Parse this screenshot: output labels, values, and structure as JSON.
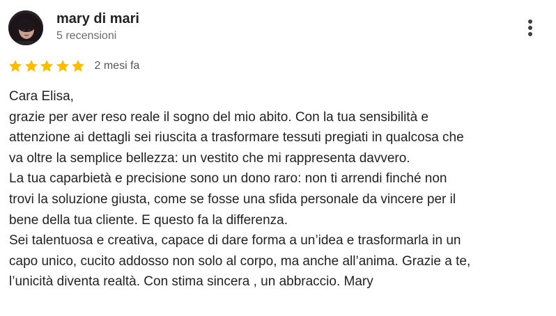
{
  "reviewer": {
    "name": "mary di mari",
    "review_count": "5 recensioni"
  },
  "rating": {
    "stars": 5,
    "max": 5,
    "star_color": "#fbbc04",
    "date": "2 mesi fa"
  },
  "menu": {
    "icon": "more-vertical-icon"
  },
  "review": {
    "lines": [
      "Cara Elisa,",
      "grazie per aver reso reale il sogno del mio abito. Con la tua sensibilità e",
      "attenzione ai dettagli sei riuscita a trasformare tessuti pregiati in qualcosa che",
      "va oltre la semplice bellezza: un vestito che mi rappresenta davvero.",
      "La tua caparbietà e precisione sono un dono raro: non ti arrendi finché non",
      "trovi la soluzione giusta, come se fosse una sfida personale da vincere per il",
      "bene della tua cliente. E questo fa la differenza.",
      "Sei talentuosa e creativa, capace di dare forma a un’idea e trasformarla in un",
      "capo unico, cucito addosso non solo al corpo, ma anche all’anima. Grazie a te,",
      "l’unicità diventa realtà. Con stima sincera , un abbraccio. Mary"
    ]
  }
}
